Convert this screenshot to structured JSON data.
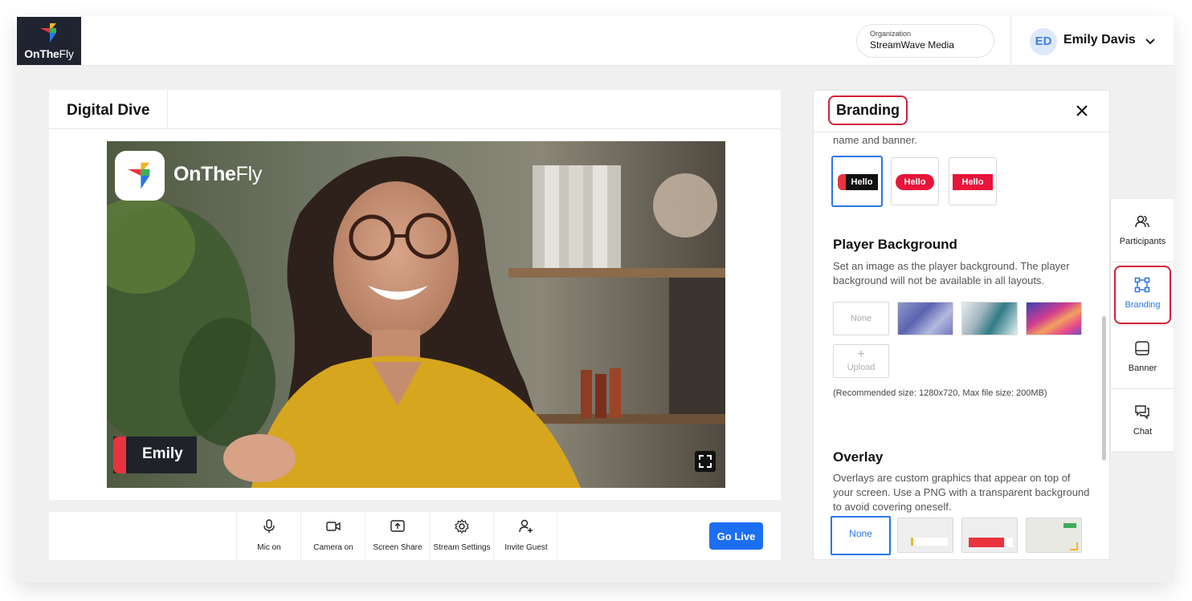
{
  "app": {
    "logo_text_bold": "OnThe",
    "logo_text_light": "Fly"
  },
  "organization": {
    "label": "Organization",
    "name": "StreamWave Media"
  },
  "user": {
    "initials": "ED",
    "name": "Emily Davis"
  },
  "stage": {
    "title": "Digital Dive",
    "brand_text_bold": "OnThe",
    "brand_text_light": "Fly",
    "participant_name": "Emily"
  },
  "controls": {
    "items": [
      {
        "label": "Mic on",
        "icon": "mic-icon"
      },
      {
        "label": "Camera on",
        "icon": "camera-icon"
      },
      {
        "label": "Screen Share",
        "icon": "screen-share-icon"
      },
      {
        "label": "Stream Settings",
        "icon": "gear-icon"
      },
      {
        "label": "Invite Guest",
        "icon": "add-user-icon"
      }
    ],
    "go_live": "Go Live"
  },
  "panel": {
    "title": "Branding",
    "intro_tail": "name and banner.",
    "banner_styles": [
      {
        "label": "Hello",
        "selected": true
      },
      {
        "label": "Hello",
        "selected": false
      },
      {
        "label": "Hello",
        "selected": false
      }
    ],
    "player_background": {
      "heading": "Player Background",
      "description": "Set an image as the player background. The player background will not be available in all layouts.",
      "none_label": "None",
      "upload_label": "Upload",
      "recommendation": "(Recommended size: 1280x720, Max file size: 200MB)"
    },
    "overlay": {
      "heading": "Overlay",
      "description": "Overlays are custom graphics that appear on top of your screen. Use a PNG with a transparent background to avoid covering oneself.",
      "none_label": "None"
    }
  },
  "side_tabs": [
    {
      "label": "Participants",
      "icon": "participants-icon",
      "active": false
    },
    {
      "label": "Branding",
      "icon": "branding-icon",
      "active": true
    },
    {
      "label": "Banner",
      "icon": "banner-icon",
      "active": false
    },
    {
      "label": "Chat",
      "icon": "chat-icon",
      "active": false
    }
  ],
  "colors": {
    "accent": "#1d6ff2",
    "brand_red": "#e8343e",
    "highlight": "#d31f3a"
  }
}
